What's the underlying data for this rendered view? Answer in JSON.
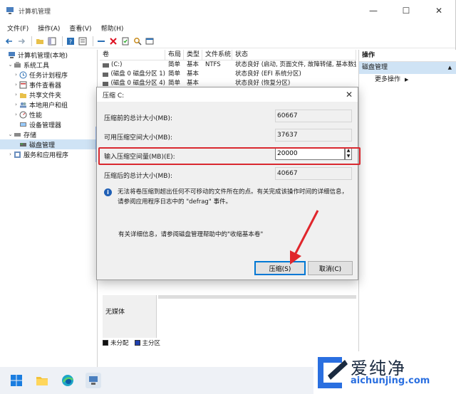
{
  "window": {
    "title": "计算机管理",
    "minimize": "—",
    "maximize": "☐",
    "close": "✕"
  },
  "menu": [
    "文件(F)",
    "操作(A)",
    "查看(V)",
    "帮助(H)"
  ],
  "tree": {
    "root": "计算机管理(本地)",
    "system_tools": "系统工具",
    "task_scheduler": "任务计划程序",
    "event_viewer": "事件查看器",
    "shared_folders": "共享文件夹",
    "local_users": "本地用户和组",
    "performance": "性能",
    "device_manager": "设备管理器",
    "storage": "存储",
    "disk_management": "磁盘管理",
    "services_apps": "服务和应用程序"
  },
  "volumes": {
    "headers": [
      "卷",
      "布局",
      "类型",
      "文件系统",
      "状态"
    ],
    "rows": [
      [
        "(C:)",
        "简单",
        "基本",
        "NTFS",
        "状态良好 (启动, 页面文件, 故障转储, 基本数据"
      ],
      [
        "(磁盘 0 磁盘分区 1)",
        "简单",
        "基本",
        "",
        "状态良好 (EFI 系统分区)"
      ],
      [
        "(磁盘 0 磁盘分区 4)",
        "简单",
        "基本",
        "",
        "状态良好 (恢复分区)"
      ]
    ]
  },
  "disk_area": {
    "no_media": "无媒体",
    "legend_unallocated": "未分配",
    "legend_primary": "主分区"
  },
  "actions": {
    "header": "操作",
    "section": "磁盘管理",
    "more": "更多操作",
    "section_arrow": "▲",
    "more_arrow": "▶"
  },
  "dialog": {
    "title": "压缩 C:",
    "close": "✕",
    "total_before_label": "压缩前的总计大小(MB):",
    "total_before_value": "60667",
    "available_label": "可用压缩空间大小(MB):",
    "available_value": "37637",
    "shrink_label": "输入压缩空间量(MB)(E):",
    "shrink_value": "20000",
    "total_after_label": "压缩后的总计大小(MB):",
    "total_after_value": "40667",
    "info_text": "无法将卷压缩到超出任何不可移动的文件所在的点。有关完成该操作时间的详细信息，请参阅应用程序日志中的 \"defrag\" 事件。",
    "more_info": "有关详细信息，请参阅磁盘管理帮助中的\"收缩基本卷\"",
    "shrink_button": "压缩(S)",
    "cancel_button": "取消(C)"
  },
  "watermark": {
    "brand": "爱纯净",
    "url": "aichunjing.com"
  },
  "colors": {
    "highlight_red": "#d9282f",
    "selection_blue": "#cfe3f5",
    "primary_partition": "#1f3fae",
    "unallocated": "#111111"
  }
}
